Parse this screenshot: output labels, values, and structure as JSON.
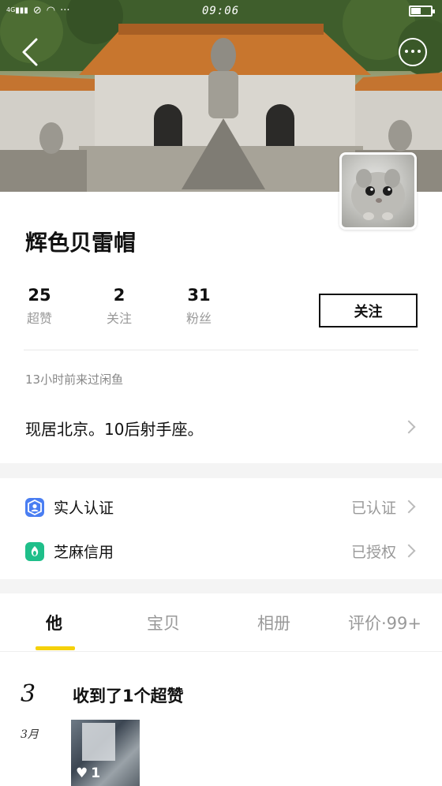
{
  "status_bar": {
    "time": "09:06",
    "network": "4G",
    "signal_icons": [
      "signal-icon",
      "blocked-icon",
      "wifi-icon",
      "more-dots-icon"
    ]
  },
  "header": {
    "back_icon": "chevron-left-icon",
    "more_icon": "more-circle-icon"
  },
  "profile": {
    "username": "辉色贝雷帽",
    "stats": [
      {
        "value": "25",
        "label": "超赞"
      },
      {
        "value": "2",
        "label": "关注"
      },
      {
        "value": "31",
        "label": "粉丝"
      }
    ],
    "follow_label": "关注",
    "last_seen": "13小时前来过闲鱼",
    "bio": "现居北京。10后射手座。"
  },
  "verification": [
    {
      "icon": "person-verify-icon",
      "label": "实人认证",
      "status": "已认证",
      "color": "#4a7ef2"
    },
    {
      "icon": "sesame-credit-icon",
      "label": "芝麻信用",
      "status": "已授权",
      "color": "#1fbf8a"
    }
  ],
  "tabs": [
    {
      "label": "他",
      "active": true
    },
    {
      "label": "宝贝",
      "active": false
    },
    {
      "label": "相册",
      "active": false
    },
    {
      "label": "评价·99+",
      "active": false
    }
  ],
  "feed": {
    "day": "3",
    "month": "3月",
    "title": "收到了1个超赞",
    "likes": "1"
  },
  "colors": {
    "accent": "#f5d10a",
    "text": "#111111",
    "muted": "#999999",
    "background": "#f4f4f4"
  }
}
